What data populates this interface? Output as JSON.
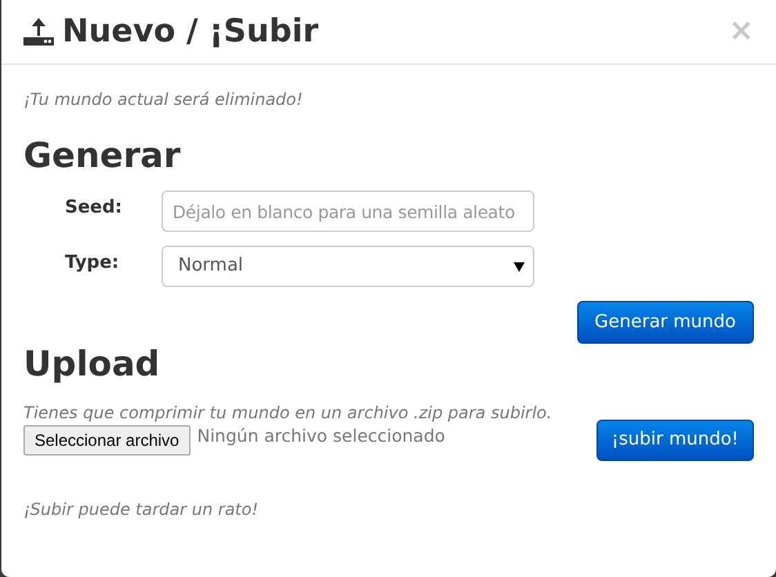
{
  "dialog": {
    "title": "Nuevo / ¡Subir",
    "close": "×"
  },
  "warning": "¡Tu mundo actual será eliminado!",
  "generate": {
    "heading": "Generar",
    "fields": [
      {
        "kind": "text",
        "label": "Seed:",
        "placeholder": "Déjalo en blanco para una semilla aleato"
      },
      {
        "kind": "select",
        "label": "Type:",
        "value": "Normal"
      }
    ],
    "button": "Generar mundo"
  },
  "upload": {
    "heading": "Upload",
    "note": "Tienes que comprimir tu mundo en un archivo .zip para subirlo.",
    "file_button": "Seleccionar archivo",
    "file_status": "Ningún archivo seleccionado",
    "button": "¡subir mundo!",
    "footer_note": "¡Subir puede tardar un rato!"
  }
}
